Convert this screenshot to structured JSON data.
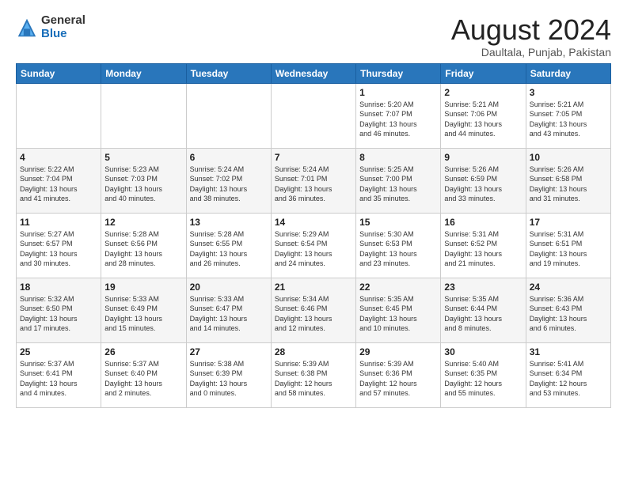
{
  "header": {
    "logo_general": "General",
    "logo_blue": "Blue",
    "title": "August 2024",
    "subtitle": "Daultala, Punjab, Pakistan"
  },
  "days_of_week": [
    "Sunday",
    "Monday",
    "Tuesday",
    "Wednesday",
    "Thursday",
    "Friday",
    "Saturday"
  ],
  "weeks": [
    [
      {
        "day": "",
        "info": ""
      },
      {
        "day": "",
        "info": ""
      },
      {
        "day": "",
        "info": ""
      },
      {
        "day": "",
        "info": ""
      },
      {
        "day": "1",
        "info": "Sunrise: 5:20 AM\nSunset: 7:07 PM\nDaylight: 13 hours\nand 46 minutes."
      },
      {
        "day": "2",
        "info": "Sunrise: 5:21 AM\nSunset: 7:06 PM\nDaylight: 13 hours\nand 44 minutes."
      },
      {
        "day": "3",
        "info": "Sunrise: 5:21 AM\nSunset: 7:05 PM\nDaylight: 13 hours\nand 43 minutes."
      }
    ],
    [
      {
        "day": "4",
        "info": "Sunrise: 5:22 AM\nSunset: 7:04 PM\nDaylight: 13 hours\nand 41 minutes."
      },
      {
        "day": "5",
        "info": "Sunrise: 5:23 AM\nSunset: 7:03 PM\nDaylight: 13 hours\nand 40 minutes."
      },
      {
        "day": "6",
        "info": "Sunrise: 5:24 AM\nSunset: 7:02 PM\nDaylight: 13 hours\nand 38 minutes."
      },
      {
        "day": "7",
        "info": "Sunrise: 5:24 AM\nSunset: 7:01 PM\nDaylight: 13 hours\nand 36 minutes."
      },
      {
        "day": "8",
        "info": "Sunrise: 5:25 AM\nSunset: 7:00 PM\nDaylight: 13 hours\nand 35 minutes."
      },
      {
        "day": "9",
        "info": "Sunrise: 5:26 AM\nSunset: 6:59 PM\nDaylight: 13 hours\nand 33 minutes."
      },
      {
        "day": "10",
        "info": "Sunrise: 5:26 AM\nSunset: 6:58 PM\nDaylight: 13 hours\nand 31 minutes."
      }
    ],
    [
      {
        "day": "11",
        "info": "Sunrise: 5:27 AM\nSunset: 6:57 PM\nDaylight: 13 hours\nand 30 minutes."
      },
      {
        "day": "12",
        "info": "Sunrise: 5:28 AM\nSunset: 6:56 PM\nDaylight: 13 hours\nand 28 minutes."
      },
      {
        "day": "13",
        "info": "Sunrise: 5:28 AM\nSunset: 6:55 PM\nDaylight: 13 hours\nand 26 minutes."
      },
      {
        "day": "14",
        "info": "Sunrise: 5:29 AM\nSunset: 6:54 PM\nDaylight: 13 hours\nand 24 minutes."
      },
      {
        "day": "15",
        "info": "Sunrise: 5:30 AM\nSunset: 6:53 PM\nDaylight: 13 hours\nand 23 minutes."
      },
      {
        "day": "16",
        "info": "Sunrise: 5:31 AM\nSunset: 6:52 PM\nDaylight: 13 hours\nand 21 minutes."
      },
      {
        "day": "17",
        "info": "Sunrise: 5:31 AM\nSunset: 6:51 PM\nDaylight: 13 hours\nand 19 minutes."
      }
    ],
    [
      {
        "day": "18",
        "info": "Sunrise: 5:32 AM\nSunset: 6:50 PM\nDaylight: 13 hours\nand 17 minutes."
      },
      {
        "day": "19",
        "info": "Sunrise: 5:33 AM\nSunset: 6:49 PM\nDaylight: 13 hours\nand 15 minutes."
      },
      {
        "day": "20",
        "info": "Sunrise: 5:33 AM\nSunset: 6:47 PM\nDaylight: 13 hours\nand 14 minutes."
      },
      {
        "day": "21",
        "info": "Sunrise: 5:34 AM\nSunset: 6:46 PM\nDaylight: 13 hours\nand 12 minutes."
      },
      {
        "day": "22",
        "info": "Sunrise: 5:35 AM\nSunset: 6:45 PM\nDaylight: 13 hours\nand 10 minutes."
      },
      {
        "day": "23",
        "info": "Sunrise: 5:35 AM\nSunset: 6:44 PM\nDaylight: 13 hours\nand 8 minutes."
      },
      {
        "day": "24",
        "info": "Sunrise: 5:36 AM\nSunset: 6:43 PM\nDaylight: 13 hours\nand 6 minutes."
      }
    ],
    [
      {
        "day": "25",
        "info": "Sunrise: 5:37 AM\nSunset: 6:41 PM\nDaylight: 13 hours\nand 4 minutes."
      },
      {
        "day": "26",
        "info": "Sunrise: 5:37 AM\nSunset: 6:40 PM\nDaylight: 13 hours\nand 2 minutes."
      },
      {
        "day": "27",
        "info": "Sunrise: 5:38 AM\nSunset: 6:39 PM\nDaylight: 13 hours\nand 0 minutes."
      },
      {
        "day": "28",
        "info": "Sunrise: 5:39 AM\nSunset: 6:38 PM\nDaylight: 12 hours\nand 58 minutes."
      },
      {
        "day": "29",
        "info": "Sunrise: 5:39 AM\nSunset: 6:36 PM\nDaylight: 12 hours\nand 57 minutes."
      },
      {
        "day": "30",
        "info": "Sunrise: 5:40 AM\nSunset: 6:35 PM\nDaylight: 12 hours\nand 55 minutes."
      },
      {
        "day": "31",
        "info": "Sunrise: 5:41 AM\nSunset: 6:34 PM\nDaylight: 12 hours\nand 53 minutes."
      }
    ]
  ]
}
